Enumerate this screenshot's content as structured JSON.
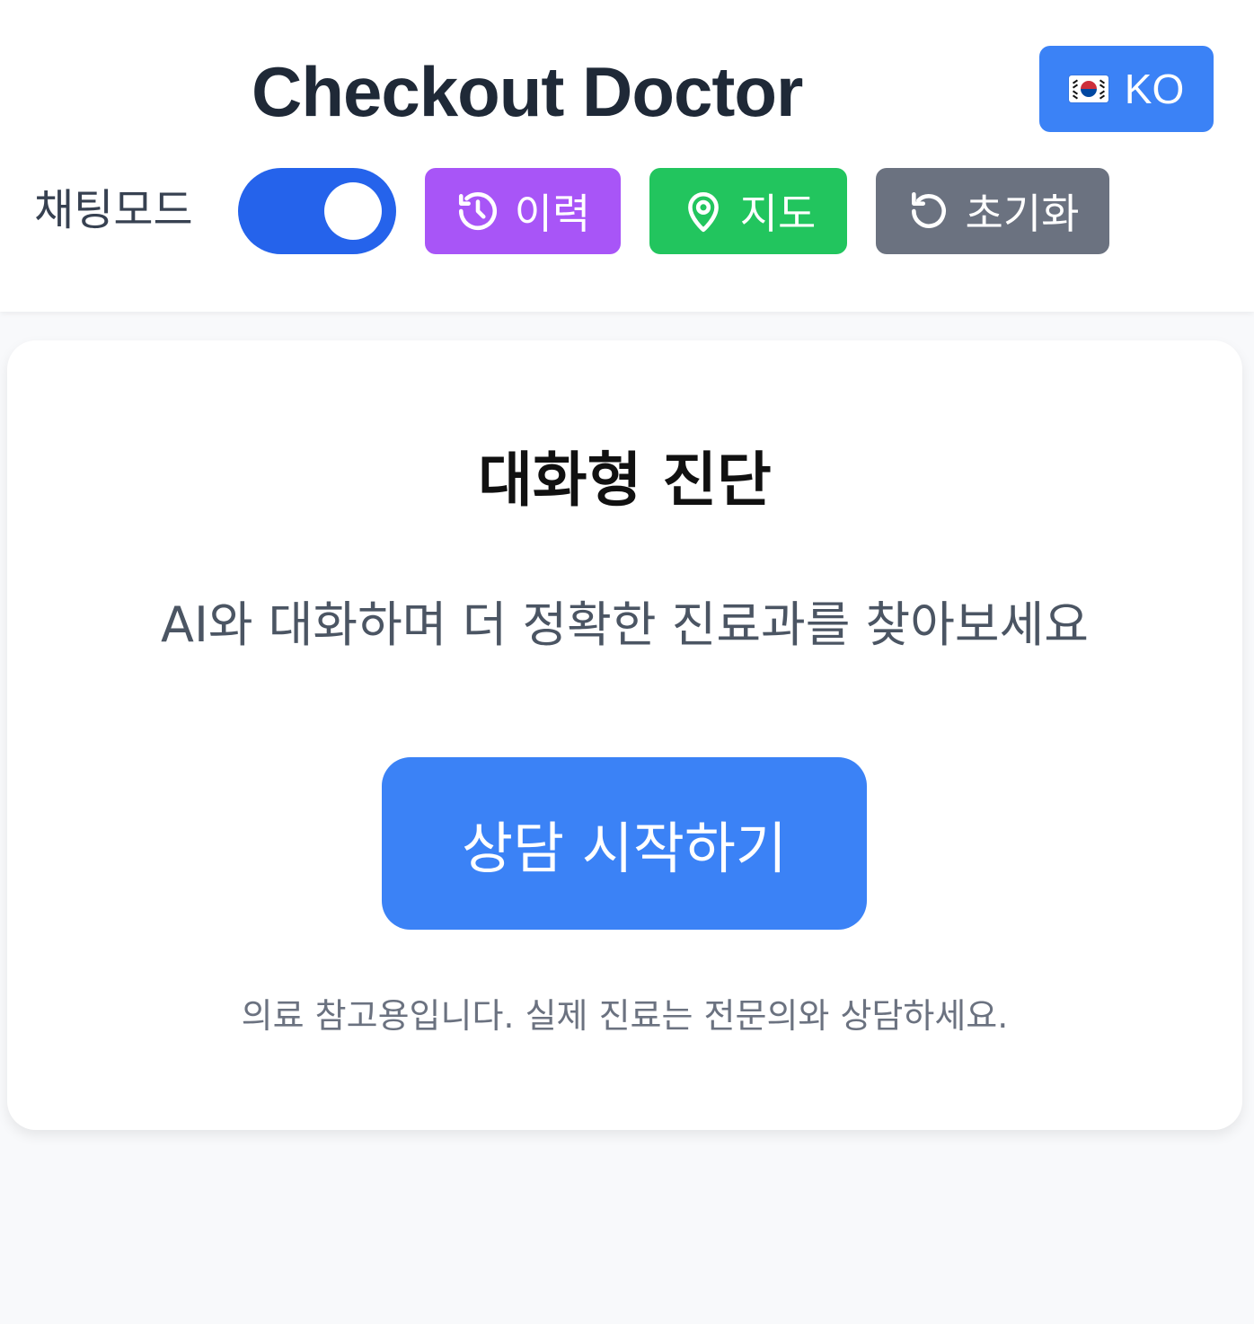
{
  "header": {
    "title": "Checkout Doctor",
    "language": {
      "flag_icon": "south-korea-flag-icon",
      "code": "KO"
    }
  },
  "toolbar": {
    "chat_mode_label": "채팅모드",
    "chat_mode_enabled": true,
    "history": {
      "label": "이력",
      "icon": "history-icon",
      "color": "#a855f7"
    },
    "map": {
      "label": "지도",
      "icon": "map-pin-icon",
      "color": "#22c55e"
    },
    "reset": {
      "label": "초기화",
      "icon": "reset-icon",
      "color": "#6b7280"
    }
  },
  "card": {
    "title": "대화형 진단",
    "subtitle": "AI와 대화하며 더 정확한 진료과를 찾아보세요",
    "start_button": "상담 시작하기",
    "disclaimer": "의료 참고용입니다. 실제 진료는 전문의와 상담하세요."
  },
  "colors": {
    "primary": "#3b82f6",
    "toggle_on": "#2563eb",
    "title_text": "#1f2937",
    "background": "#f8f9fb"
  }
}
